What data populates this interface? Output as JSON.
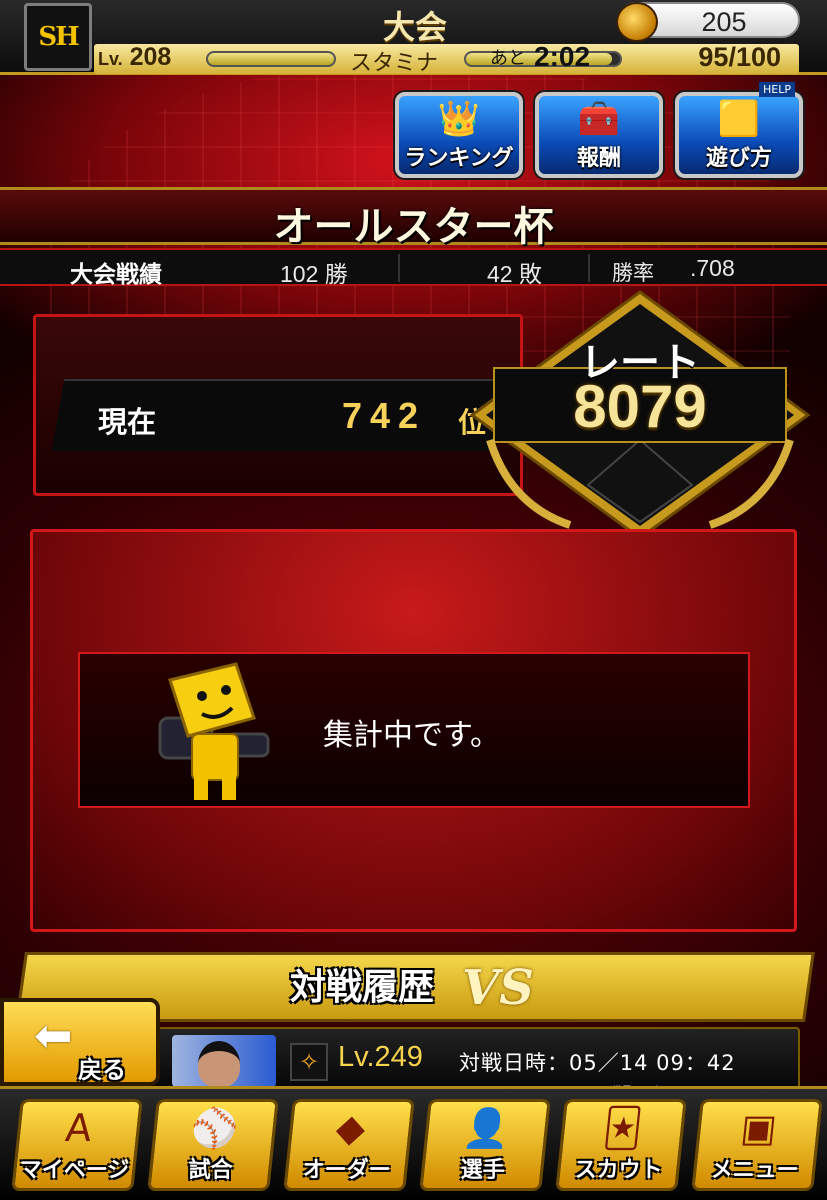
{
  "header": {
    "logo_text": "SH",
    "title": "大会",
    "coin_count": "205",
    "level_prefix": "Lv.",
    "level": "208",
    "stamina_label": "スタミナ",
    "stamina_left_label": "あと",
    "stamina_time": "2:02",
    "stamina_value": "95/100",
    "exp_fill_percent": 100,
    "stamina_fill_percent": 95
  },
  "top_buttons": {
    "ranking": "ランキング",
    "reward": "報酬",
    "help": "遊び方",
    "help_tag": "HELP"
  },
  "cup": {
    "name": "オールスター杯",
    "record_label": "大会戦績",
    "wins": "102 勝",
    "losses": "42 敗",
    "win_rate_label": "勝率",
    "win_rate": ".708"
  },
  "rank": {
    "label": "現在",
    "value": "742",
    "unit": "位"
  },
  "rate": {
    "label": "レート",
    "value": "8079"
  },
  "status": {
    "message": "集計中です。"
  },
  "history": {
    "title": "対戦履歴",
    "vs": "VS",
    "opponent_level": "Lv.249",
    "battle_date": "対戦日時：05／14 09：42",
    "rank_caption": "世界ランク"
  },
  "back_button": {
    "label": "戻る"
  },
  "bottom_nav": {
    "mypage": "マイページ",
    "game": "試合",
    "order": "オーダー",
    "players": "選手",
    "scout": "スカウト",
    "menu": "メニュー"
  },
  "colors": {
    "accent_gold": "#f6d34c",
    "panel_red": "#d21818",
    "nav_yellow": "#ffe04a"
  }
}
